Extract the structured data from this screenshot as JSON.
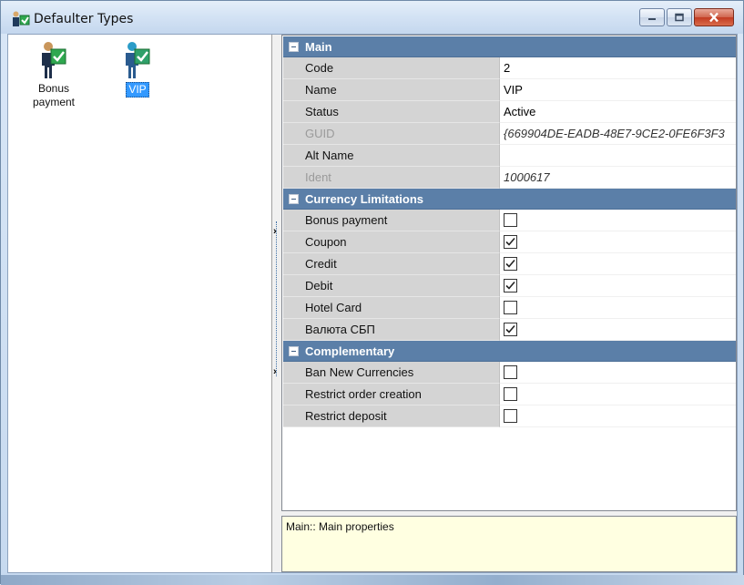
{
  "window": {
    "title": "Defaulter Types"
  },
  "types": [
    {
      "label": "Bonus payment",
      "selected": false
    },
    {
      "label": "VIP",
      "selected": true
    }
  ],
  "sections": {
    "main": {
      "label": "Main",
      "rows": {
        "code": {
          "name": "Code",
          "value": "2"
        },
        "name": {
          "name": "Name",
          "value": "VIP"
        },
        "status": {
          "name": "Status",
          "value": "Active"
        },
        "guid": {
          "name": "GUID",
          "value": "{669904DE-EADB-48E7-9CE2-0FE6F3F3"
        },
        "altname": {
          "name": "Alt Name",
          "value": ""
        },
        "ident": {
          "name": "Ident",
          "value": "1000617"
        }
      }
    },
    "currency": {
      "label": "Currency Limitations",
      "rows": {
        "bonus": {
          "name": "Bonus payment",
          "checked": false
        },
        "coupon": {
          "name": "Coupon",
          "checked": true
        },
        "credit": {
          "name": "Credit",
          "checked": true
        },
        "debit": {
          "name": "Debit",
          "checked": true
        },
        "hotel": {
          "name": "Hotel Card",
          "checked": false
        },
        "sbp": {
          "name": "Валюта СБП",
          "checked": true
        }
      }
    },
    "complementary": {
      "label": "Complementary",
      "rows": {
        "ban": {
          "name": "Ban New Currencies",
          "checked": false
        },
        "restrict_order": {
          "name": "Restrict order creation",
          "checked": false
        },
        "restrict_deposit": {
          "name": "Restrict deposit",
          "checked": false
        }
      }
    }
  },
  "description": "Main:: Main properties",
  "colors": {
    "category_header": "#5b7fa8",
    "name_column": "#d4d4d4",
    "description_bg": "#ffffe1",
    "selection": "#3399ff"
  }
}
